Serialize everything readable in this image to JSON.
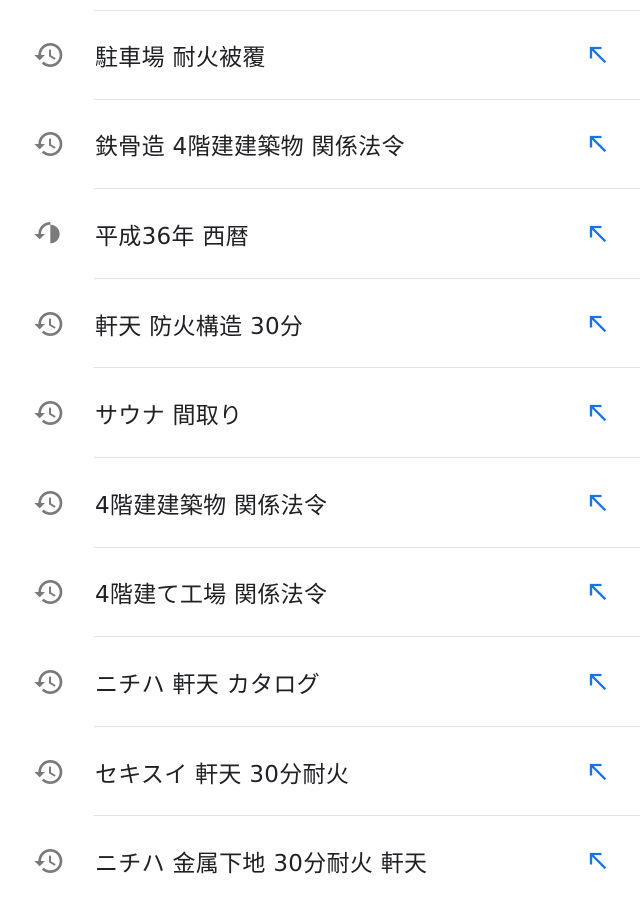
{
  "colors": {
    "history_icon": "#7a7a7a",
    "arrow_icon": "#1a73e8",
    "divider": "#e3e3e3",
    "text": "#202124"
  },
  "icons": {
    "history": "history-clock-icon",
    "fill": "north-west-arrow-icon"
  },
  "history": {
    "items": [
      {
        "text": "駐車場 耐火被覆"
      },
      {
        "text": "鉄骨造 4階建建築物 関係法令"
      },
      {
        "text": "平成36年 西暦"
      },
      {
        "text": "軒天 防火構造 30分"
      },
      {
        "text": "サウナ 間取り"
      },
      {
        "text": "4階建建築物 関係法令"
      },
      {
        "text": "4階建て工場 関係法令"
      },
      {
        "text": "ニチハ 軒天 カタログ"
      },
      {
        "text": "セキスイ 軒天 30分耐火"
      },
      {
        "text": "ニチハ 金属下地 30分耐火 軒天"
      }
    ]
  }
}
